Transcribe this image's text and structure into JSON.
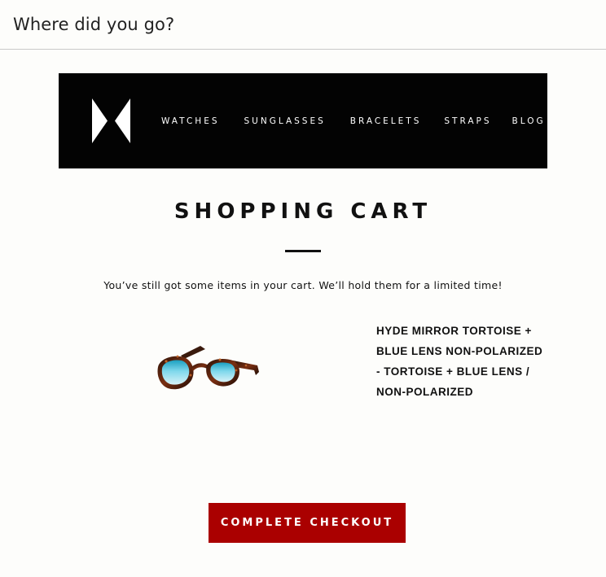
{
  "email": {
    "subject": "Where did you go?"
  },
  "header": {
    "logo_icon": "bowtie-logo-icon",
    "nav": [
      {
        "label": "WATCHES"
      },
      {
        "label": "SUNGLASSES"
      },
      {
        "label": "BRACELETS"
      },
      {
        "label": "STRAPS"
      },
      {
        "label": "BLOG"
      }
    ]
  },
  "cart": {
    "title": "SHOPPING CART",
    "message": "You’ve still got some items in your cart. We’ll hold them for a limited time!",
    "items": [
      {
        "image_icon": "sunglasses-product-image",
        "name": "HYDE MIRROR TORTOISE + BLUE LENS NON-POLARIZED - TORTOISE + BLUE LENS / NON-POLARIZED"
      }
    ],
    "checkout_label": "COMPLETE CHECKOUT"
  },
  "colors": {
    "header_bg": "#030303",
    "button_bg": "#aa0000",
    "text": "#111111"
  }
}
